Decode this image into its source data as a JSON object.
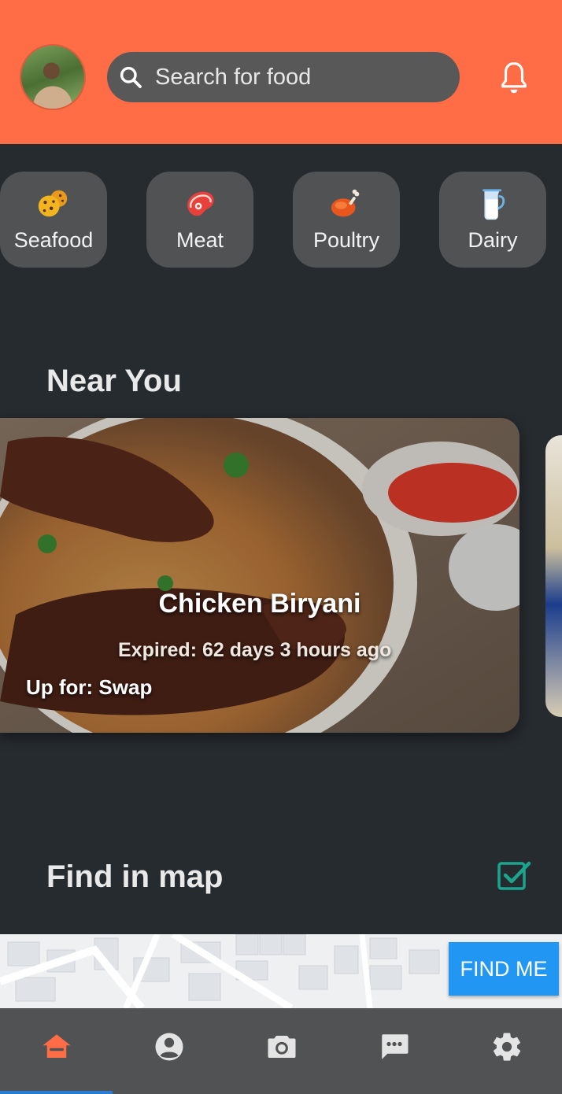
{
  "header": {
    "search_placeholder": "Search for food",
    "accent_color": "#ff6d46"
  },
  "categories": [
    {
      "label": "Seafood",
      "icon": "cookie-icon"
    },
    {
      "label": "Meat",
      "icon": "steak-icon"
    },
    {
      "label": "Poultry",
      "icon": "chicken-leg-icon"
    },
    {
      "label": "Dairy",
      "icon": "milk-jug-icon"
    }
  ],
  "near_you": {
    "title": "Near You",
    "card": {
      "name": "Chicken Biryani",
      "expired": "Expired: 62 days 3 hours ago",
      "up_for": "Up for: Swap"
    }
  },
  "map_section": {
    "title": "Find in map",
    "find_me_label": "FIND ME",
    "checked": true
  },
  "bottom_nav": [
    {
      "name": "home",
      "icon": "home-icon",
      "active": true
    },
    {
      "name": "profile",
      "icon": "account-circle-icon"
    },
    {
      "name": "camera",
      "icon": "camera-icon"
    },
    {
      "name": "messages",
      "icon": "chat-icon"
    },
    {
      "name": "settings",
      "icon": "gear-icon"
    }
  ]
}
